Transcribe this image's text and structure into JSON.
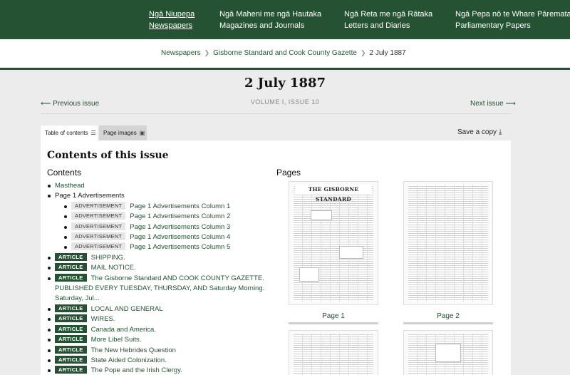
{
  "topnav": {
    "items": [
      {
        "line1": "Ngā Niupepa",
        "line2": "Newspapers"
      },
      {
        "line1": "Ngā Maheni me ngā Hautaka",
        "line2": "Magazines and Journals"
      },
      {
        "line1": "Ngā Reta me ngā Rātaka",
        "line2": "Letters and Diaries"
      },
      {
        "line1": "Ngā Pepa nō te Whare Pāremata",
        "line2": "Parliamentary Papers"
      }
    ]
  },
  "breadcrumb": {
    "items": [
      "Newspapers",
      "Gisborne Standard and Cook County Gazette"
    ],
    "current": "2 July 1887"
  },
  "issue": {
    "title": "2 July 1887",
    "subtitle": "VOLUME I, ISSUE 10",
    "prev_label": "Previous issue",
    "next_label": "Next issue"
  },
  "tabs": {
    "toc_label": "Table of contents",
    "pages_label": "Page images"
  },
  "save_copy_label": "Save a copy",
  "panel": {
    "title": "Contents of this issue",
    "contents_heading": "Contents",
    "pages_heading": "Pages"
  },
  "toc": {
    "masthead": "Masthead",
    "ads_group": "Page 1 Advertisements",
    "adv_badge": "ADVERTISEMENT",
    "art_badge": "ARTICLE",
    "ads": [
      "Page 1 Advertisements Column 1",
      "Page 1 Advertisements Column 2",
      "Page 1 Advertisements Column 3",
      "Page 1 Advertisements Column 4",
      "Page 1 Advertisements Column 5"
    ],
    "articles": [
      "SHIPPING.",
      "MAIL NOTICE.",
      "The Gisborne Standard AND COOK COUNTY GAZETTE. PUBLISHED EVERY TUESDAY, THURSDAY, AND Saturday Morning. Saturday, Jul...",
      "LOCAL AND GENERAL",
      "WIRES.",
      "Canada and America.",
      "More Libel Suits.",
      "The New Hebrides Question",
      "State Aided Colonization.",
      "The Pope and the Irish Clergy."
    ]
  },
  "pages": {
    "masthead_text": "THE GISBORNE STANDARD",
    "labels": [
      "Page 1",
      "Page 2"
    ]
  }
}
